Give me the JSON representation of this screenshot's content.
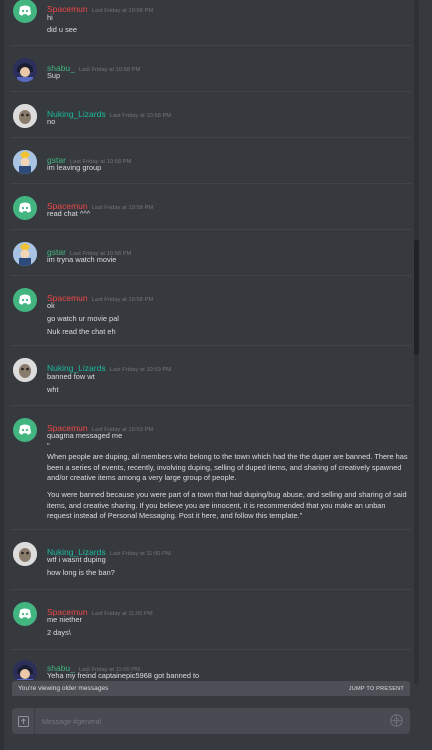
{
  "colors": {
    "background": "#36393e",
    "text": "#dcddde",
    "timestamp": "#72767d",
    "spacemun": "#f04747",
    "shabu": "#43b581",
    "nuking": "#1abc9c",
    "gstar": "#43b581",
    "discord_avatar_bg": "#43b581"
  },
  "messages": [
    {
      "username": "Spacemun",
      "timestamp": "Last Friday at 10:58 PM",
      "lines": [
        "hi",
        "did u see"
      ]
    },
    {
      "username": "shabu_",
      "timestamp": "Last Friday at 10:58 PM",
      "lines": [
        "Sup"
      ]
    },
    {
      "username": "Nuking_Lizards",
      "timestamp": "Last Friday at 10:58 PM",
      "lines": [
        "no"
      ]
    },
    {
      "username": "gstar",
      "timestamp": "Last Friday at 10:58 PM",
      "lines": [
        "im leaving group"
      ]
    },
    {
      "username": "Spacemun",
      "timestamp": "Last Friday at 10:58 PM",
      "lines": [
        "read chat ^^^"
      ]
    },
    {
      "username": "gstar",
      "timestamp": "Last Friday at 10:58 PM",
      "lines": [
        "im tryna watch movie"
      ]
    },
    {
      "username": "Spacemun",
      "timestamp": "Last Friday at 10:58 PM",
      "lines": [
        "ok",
        "go watch ur movie pal",
        "Nuk read the chat eh"
      ]
    },
    {
      "username": "Nuking_Lizards",
      "timestamp": "Last Friday at 10:59 PM",
      "lines": [
        "banned fow wt",
        "wht"
      ]
    },
    {
      "username": "Spacemun",
      "timestamp": "Last Friday at 10:59 PM",
      "lines": [
        "quagma messaged me",
        "\"",
        "When people are duping, all members who belong to the town which had the the duper are banned. There has been a series of events, recently, involving duping, selling of duped items, and sharing of creatively spawned and/or creative items among a very large group of people.",
        "You were banned because you were part of a town that had duping/bug abuse, and selling and sharing of said items, and creative sharing. If you believe you are innocent, it is recommended that you make an unban request instead of Personal Messaging. Post it here, and follow this template.\""
      ]
    },
    {
      "username": "Nuking_Lizards",
      "timestamp": "Last Friday at 11:00 PM",
      "lines": [
        "wtf i wasnt duping",
        "how long is the ban?"
      ]
    },
    {
      "username": "Spacemun",
      "timestamp": "Last Friday at 11:00 PM",
      "lines": [
        "me niether",
        "2 days\\"
      ]
    },
    {
      "username": "shabu_",
      "timestamp": "Last Friday at 11:00 PM",
      "lines": [
        "Yeha my freind captainepic5968 got banned to"
      ]
    }
  ],
  "older_bar": {
    "text": "You're viewing older messages",
    "jump": "JUMP TO PRESENT"
  },
  "composer": {
    "placeholder": "Message #general",
    "upload_icon": "upload-icon",
    "emoji_icon": "emoji-icon"
  }
}
